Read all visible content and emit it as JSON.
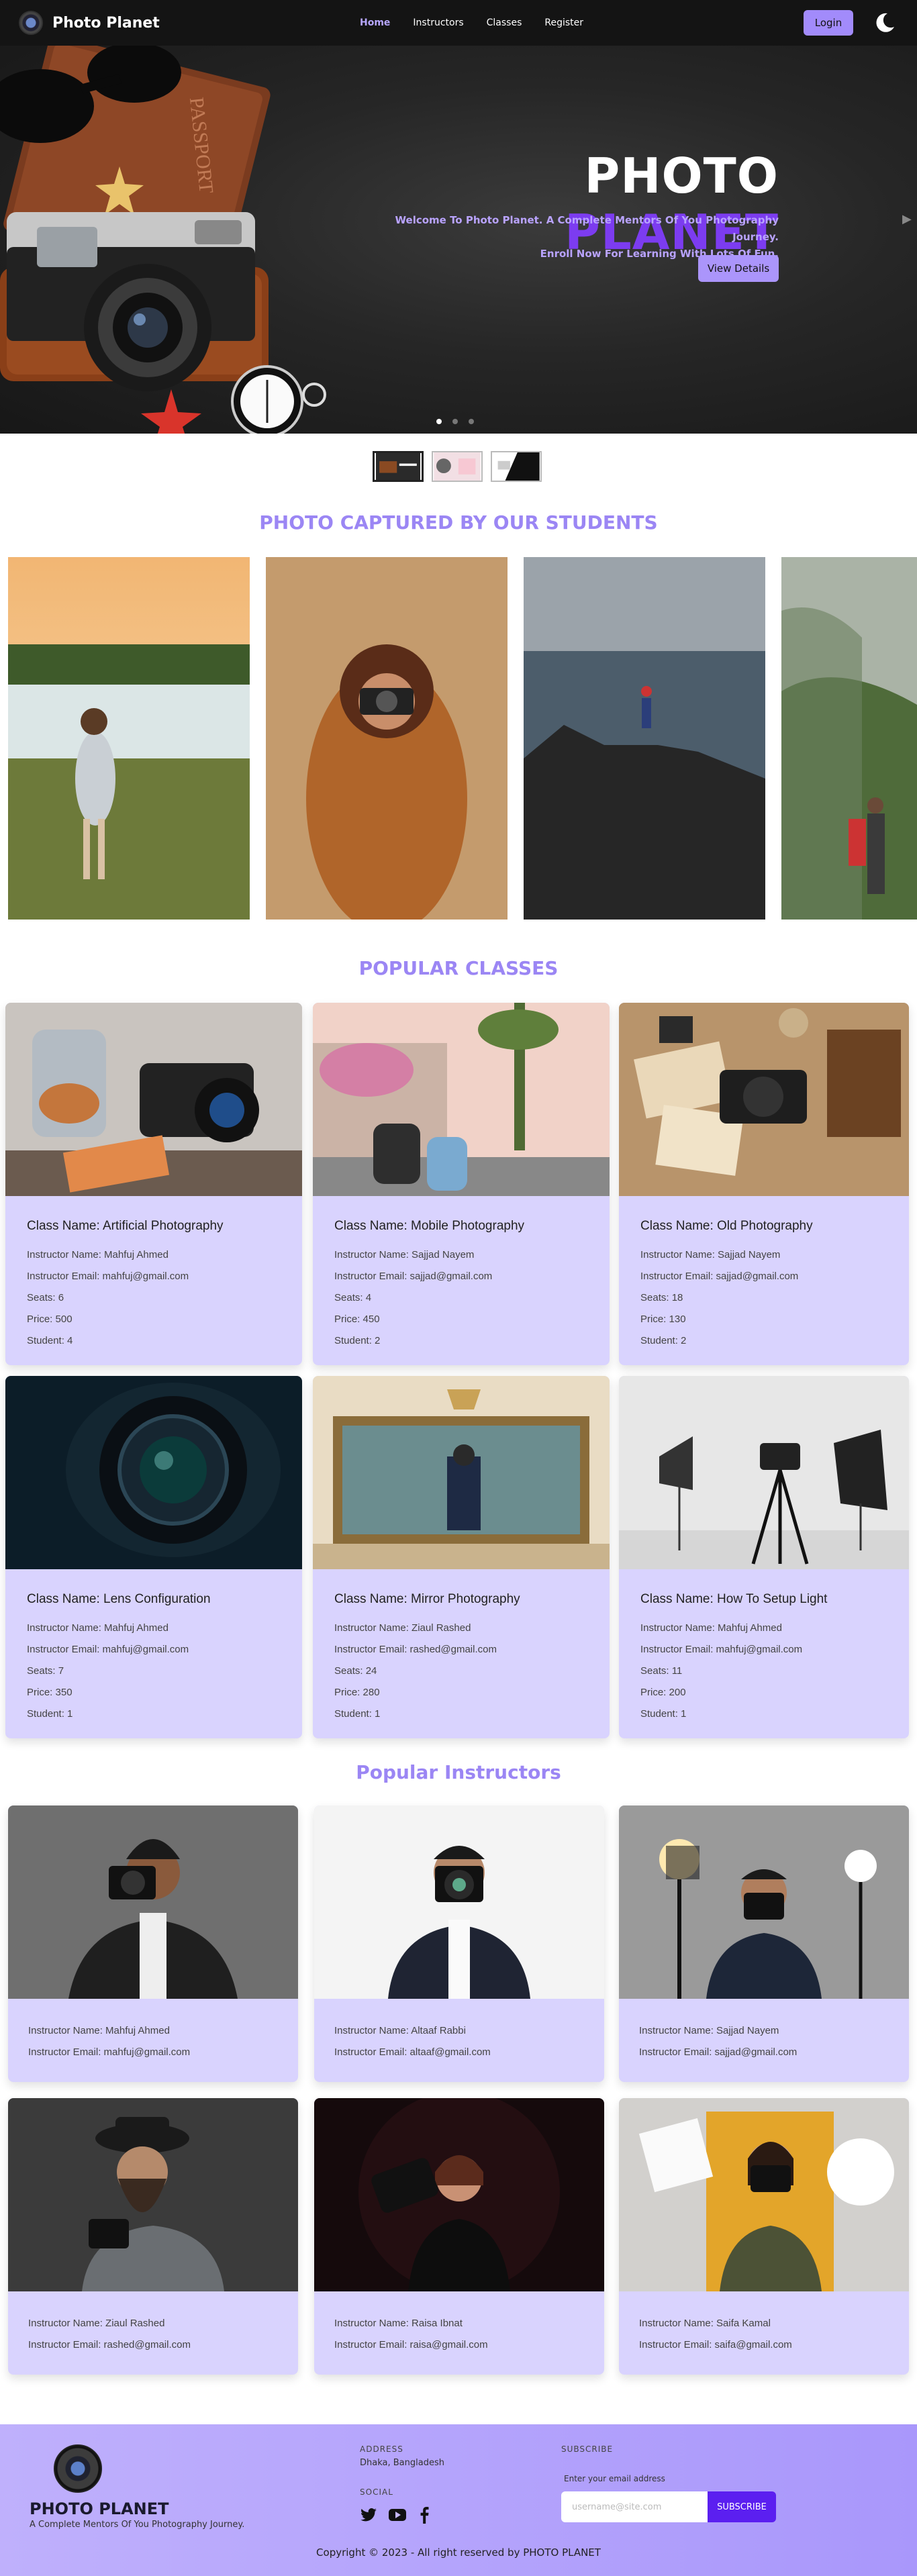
{
  "nav": {
    "brand": "Photo Planet",
    "links": [
      "Home",
      "Instructors",
      "Classes",
      "Register"
    ],
    "login": "Login"
  },
  "hero": {
    "title_a": "PHOTO",
    "title_b": "PLANET",
    "subtitle_1": "Welcome To Photo Planet. A Complete Mentors Of You Photography Journey.",
    "subtitle_2": "Enroll Now For Learning With Lots Of Fun.",
    "button": "View Details",
    "passport_text": "PASSPORT"
  },
  "students": {
    "heading": "PHOTO CAPTURED BY OUR STUDENTS"
  },
  "classes": {
    "heading": "POPULAR CLASSES",
    "items": [
      {
        "name": "Class Name: Artificial Photography",
        "instructor": "Instructor Name: Mahfuj Ahmed",
        "email": "Instructor Email: mahfuj@gmail.com",
        "seats": "Seats: 6",
        "price": "Price: 500",
        "student": "Student: 4"
      },
      {
        "name": "Class Name: Mobile Photography",
        "instructor": "Instructor Name: Sajjad Nayem",
        "email": "Instructor Email: sajjad@gmail.com",
        "seats": "Seats: 4",
        "price": "Price: 450",
        "student": "Student: 2"
      },
      {
        "name": "Class Name: Old Photography",
        "instructor": "Instructor Name: Sajjad Nayem",
        "email": "Instructor Email: sajjad@gmail.com",
        "seats": "Seats: 18",
        "price": "Price: 130",
        "student": "Student: 2"
      },
      {
        "name": "Class Name: Lens Configuration",
        "instructor": "Instructor Name: Mahfuj Ahmed",
        "email": "Instructor Email: mahfuj@gmail.com",
        "seats": "Seats: 7",
        "price": "Price: 350",
        "student": "Student: 1"
      },
      {
        "name": "Class Name: Mirror Photography",
        "instructor": "Instructor Name: Ziaul Rashed",
        "email": "Instructor Email: rashed@gmail.com",
        "seats": "Seats: 24",
        "price": "Price: 280",
        "student": "Student: 1"
      },
      {
        "name": "Class Name: How To Setup Light",
        "instructor": "Instructor Name: Mahfuj Ahmed",
        "email": "Instructor Email: mahfuj@gmail.com",
        "seats": "Seats: 11",
        "price": "Price: 200",
        "student": "Student: 1"
      }
    ]
  },
  "instructors": {
    "heading": "Popular Instructors",
    "items": [
      {
        "name": "Instructor Name: Mahfuj Ahmed",
        "email": "Instructor Email: mahfuj@gmail.com"
      },
      {
        "name": "Instructor Name: Altaaf Rabbi",
        "email": "Instructor Email: altaaf@gmail.com"
      },
      {
        "name": "Instructor Name: Sajjad Nayem",
        "email": "Instructor Email: sajjad@gmail.com"
      },
      {
        "name": "Instructor Name: Ziaul Rashed",
        "email": "Instructor Email: rashed@gmail.com"
      },
      {
        "name": "Instructor Name: Raisa Ibnat",
        "email": "Instructor Email: raisa@gmail.com"
      },
      {
        "name": "Instructor Name: Saifa Kamal",
        "email": "Instructor Email: saifa@gmail.com"
      }
    ]
  },
  "footer": {
    "brand": "PHOTO PLANET",
    "tagline": "A Complete Mentors Of You Photography Journey.",
    "address_label": "ADDRESS",
    "address": "Dhaka, Bangladesh",
    "social_label": "SOCIAL",
    "subscribe_label": "SUBSCRIBE",
    "email_label": "Enter your email address",
    "email_placeholder": "username@site.com",
    "subscribe_button": "SUBSCRIBE",
    "copyright": "Copyright © 2023 - All right reserved by PHOTO PLANET"
  }
}
